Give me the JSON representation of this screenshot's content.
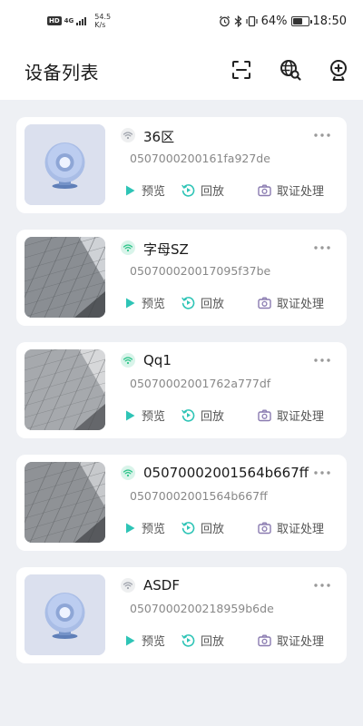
{
  "status_bar": {
    "network_badge": "HD",
    "network_type": "4G",
    "speed_value": "54.5",
    "speed_unit": "K/s",
    "battery_percent": "64%",
    "battery_level": 0.64,
    "time": "18:50"
  },
  "header": {
    "title": "设备列表",
    "icons": [
      "scan-icon",
      "globe-search-icon",
      "add-camera-icon"
    ]
  },
  "actions": {
    "preview": "预览",
    "playback": "回放",
    "evidence": "取证处理"
  },
  "colors": {
    "accent": "#2ec4b6",
    "wifi_online": "#2ec48a",
    "wifi_offline": "#a0a4ad",
    "evidence_icon": "#8a7bb0"
  },
  "devices": [
    {
      "name": "36区",
      "serial": "0507000200161fa927de",
      "online": false,
      "thumbnail": "camera-placeholder"
    },
    {
      "name": "字母SZ",
      "serial": "050700020017095f37be",
      "online": true,
      "thumbnail": "building-photo"
    },
    {
      "name": "Qq1",
      "serial": "05070002001762a777df",
      "online": true,
      "thumbnail": "building-photo"
    },
    {
      "name": "05070002001564b667ff",
      "serial": "05070002001564b667ff",
      "online": true,
      "thumbnail": "building-photo"
    },
    {
      "name": "ASDF",
      "serial": "0507000200218959b6de",
      "online": false,
      "thumbnail": "camera-placeholder"
    }
  ]
}
